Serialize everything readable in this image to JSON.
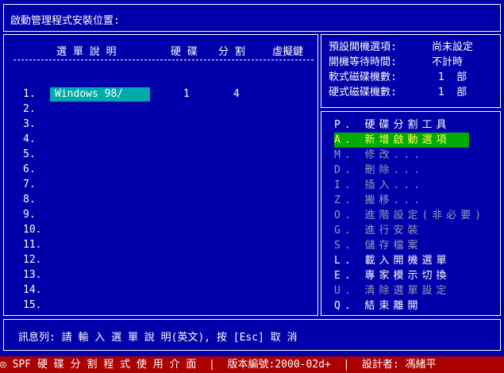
{
  "title": "啟動管理程式安裝位置:",
  "headers": {
    "name": "選 單 說 明",
    "disk": "硬 碟",
    "partition": "分 割",
    "hotkey": "虛擬鍵"
  },
  "rows": [
    {
      "num": "1.",
      "name": "Windows 98/",
      "disk": "1",
      "partition": "4"
    },
    {
      "num": "2."
    },
    {
      "num": "3."
    },
    {
      "num": "4."
    },
    {
      "num": "5."
    },
    {
      "num": "6."
    },
    {
      "num": "7."
    },
    {
      "num": "8."
    },
    {
      "num": "9."
    },
    {
      "num": "10."
    },
    {
      "num": "11."
    },
    {
      "num": "12."
    },
    {
      "num": "13."
    },
    {
      "num": "14."
    },
    {
      "num": "15."
    }
  ],
  "info": [
    {
      "label": "預設開機選項:",
      "value": "尚未設定"
    },
    {
      "label": "開機等待時間:",
      "value": "不計時"
    },
    {
      "label": "軟式磁碟機數:",
      "value": " 1  部"
    },
    {
      "label": "硬式磁碟機數:",
      "value": " 1  部"
    }
  ],
  "menu": [
    {
      "text": "P. 硬碟分割工具",
      "state": "enabled"
    },
    {
      "text": "A. 新增啟動選項",
      "state": "selected"
    },
    {
      "text": "M. 修改...",
      "state": "disabled"
    },
    {
      "text": "D. 刪除...",
      "state": "disabled"
    },
    {
      "text": "I. 插入...",
      "state": "disabled"
    },
    {
      "text": "Z. 搬移...",
      "state": "disabled"
    },
    {
      "text": "O. 進階設定(非必要)",
      "state": "disabled"
    },
    {
      "text": "G. 進行安裝",
      "state": "disabled"
    },
    {
      "text": "S. 儲存檔案",
      "state": "disabled"
    },
    {
      "text": "L. 載入開機選單",
      "state": "enabled"
    },
    {
      "text": "E. 專家模示切換",
      "state": "enabled"
    },
    {
      "text": "U. 清除選單設定",
      "state": "disabled"
    },
    {
      "text": "Q. 結束離開",
      "state": "enabled"
    }
  ],
  "message": "訊息列: 請 輸 入 選 單 說 明(英文), 按 [Esc] 取 消",
  "status_bar": "◎ SPF 硬 碟 分 割 程 式 使 用 介 面  |  版本編號:2000-02d+  |  設計者: 馮緒平",
  "colors": {
    "background": "#0000aa",
    "selected_row": "#00aaaa",
    "selected_menu": "#00aa00",
    "status_bar": "#aa0000"
  }
}
